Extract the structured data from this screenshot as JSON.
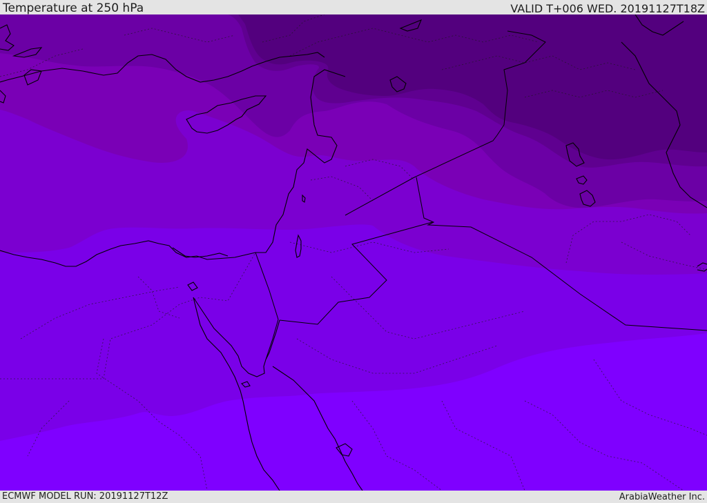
{
  "header": {
    "title": "Temperature at 250 hPa",
    "valid": "VALID T+006 WED. 20191127T18Z"
  },
  "footer": {
    "model_run": "ECMWF MODEL RUN: 20191127T12Z",
    "credit": "ArabiaWeather Inc."
  },
  "map": {
    "variable": "temperature",
    "level": "250 hPa",
    "colors": {
      "band_1_darkest": "#53007e",
      "band_2": "#5f0090",
      "band_3": "#6b00a5",
      "band_4": "#7a00b6",
      "band_5": "#8000da",
      "band_6": "#7a00e8",
      "band_7_lightest": "#7f00ff",
      "coastline": "#000000",
      "borders": "#1a1a1a"
    }
  }
}
